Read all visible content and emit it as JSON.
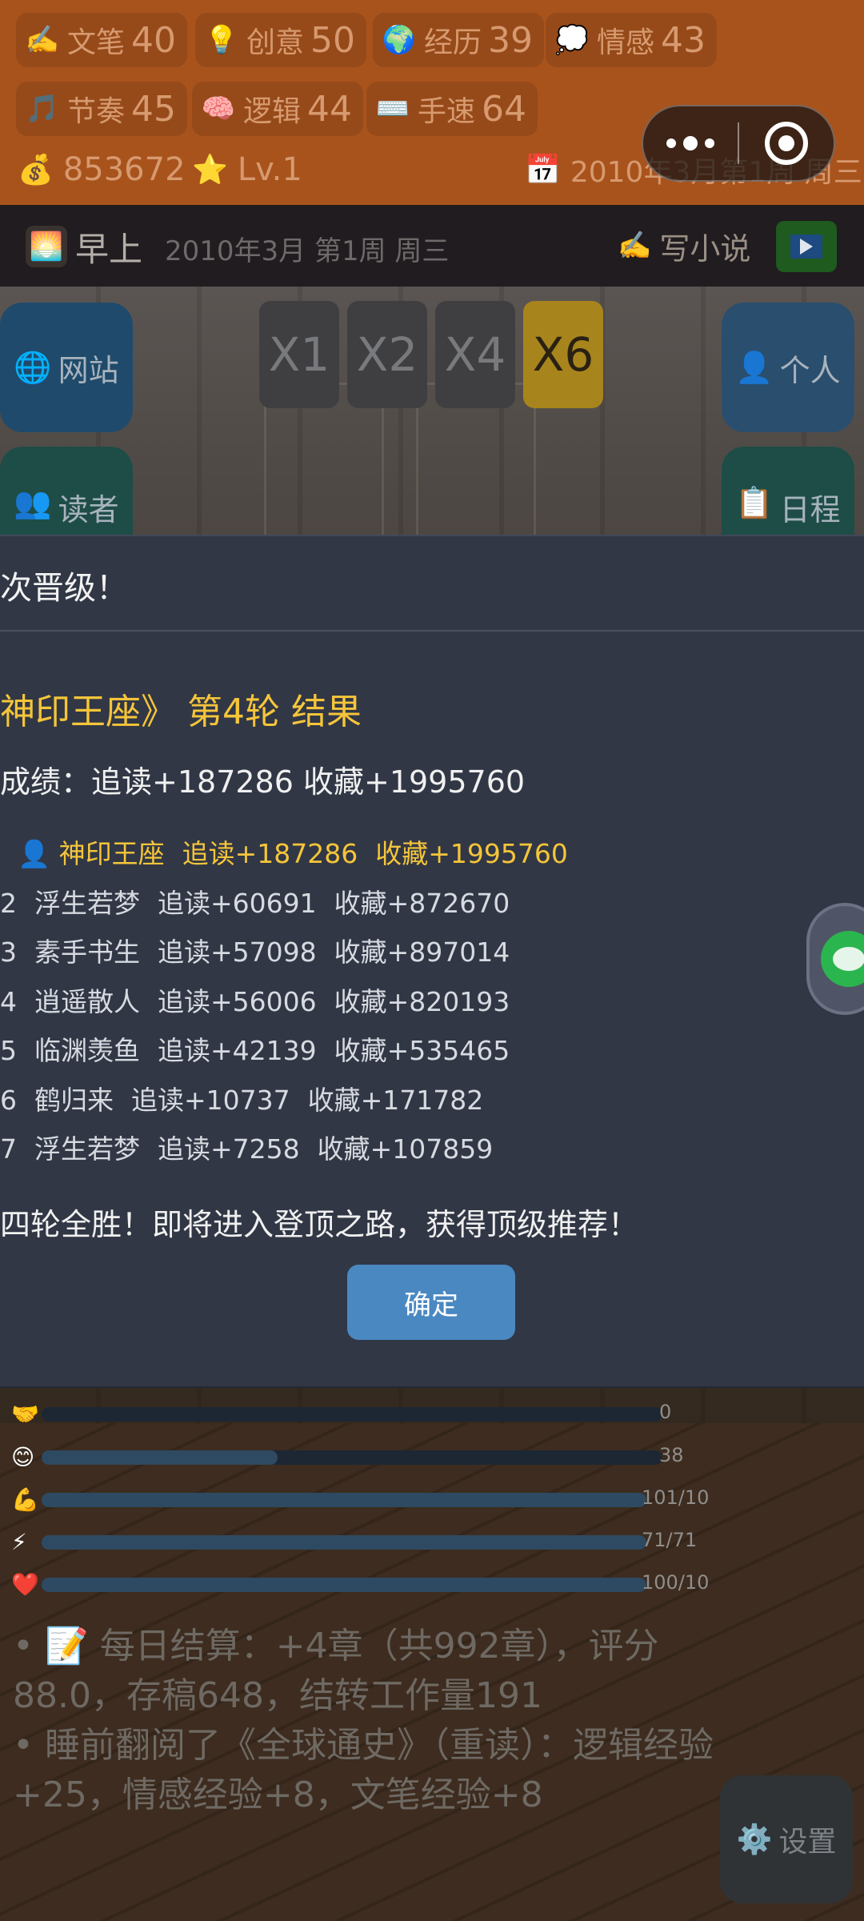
{
  "stats": [
    {
      "icon": "✍️",
      "name": "文笔",
      "value": "40"
    },
    {
      "icon": "💡",
      "name": "创意",
      "value": "50"
    },
    {
      "icon": "🌍",
      "name": "经历",
      "value": "39"
    },
    {
      "icon": "💭",
      "name": "情感",
      "value": "43"
    },
    {
      "icon": "🎵",
      "name": "节奏",
      "value": "45"
    },
    {
      "icon": "🧠",
      "name": "逻辑",
      "value": "44"
    },
    {
      "icon": "⌨️",
      "name": "手速",
      "value": "64"
    }
  ],
  "money": {
    "icon": "💰",
    "value": "853672"
  },
  "level": {
    "icon": "⭐",
    "value": "Lv.1"
  },
  "calendar": {
    "icon": "📅",
    "text": "2010年3月第1周 周三"
  },
  "time_bar": {
    "icon": "🌅",
    "period": "早上",
    "date": "2010年3月 第1周 周三",
    "write_icon": "✍️",
    "write_label": "写小说"
  },
  "side_buttons": {
    "website": {
      "icon": "🌐",
      "label": "网站"
    },
    "personal": {
      "icon": "👤",
      "label": "个人"
    },
    "reader": {
      "icon": "👥",
      "label": "读者"
    },
    "schedule": {
      "icon": "📋",
      "label": "日程"
    },
    "settings": {
      "icon": "⚙️",
      "label": "设置"
    }
  },
  "speed": {
    "options": [
      "X1",
      "X2",
      "X4",
      "X6"
    ],
    "active": "X6"
  },
  "dialog": {
    "title": "次晋级！",
    "round_title": "神印王座》 第4轮 结果",
    "score": "成绩：追读+187286  收藏+1995760",
    "rankings": [
      {
        "rank": "",
        "name": "👤 神印王座",
        "follow": "追读+187286",
        "collect": "收藏+1995760",
        "me": true
      },
      {
        "rank": "2",
        "name": "浮生若梦",
        "follow": "追读+60691",
        "collect": "收藏+872670"
      },
      {
        "rank": "3",
        "name": "素手书生",
        "follow": "追读+57098",
        "collect": "收藏+897014"
      },
      {
        "rank": "4",
        "name": "逍遥散人",
        "follow": "追读+56006",
        "collect": "收藏+820193"
      },
      {
        "rank": "5",
        "name": "临渊羡鱼",
        "follow": "追读+42139",
        "collect": "收藏+535465"
      },
      {
        "rank": "6",
        "name": "鹤归来",
        "follow": "追读+10737",
        "collect": "收藏+171782"
      },
      {
        "rank": "7",
        "name": "浮生若梦",
        "follow": "追读+7258",
        "collect": "收藏+107859"
      }
    ],
    "message": "四轮全胜！即将进入登顶之路，获得顶级推荐！",
    "confirm": "确定"
  },
  "bars": [
    {
      "icon": "🤝",
      "value": "0",
      "fraction": 0,
      "color": "#1d2734"
    },
    {
      "icon": "😊",
      "value": "38",
      "fraction": 0.38,
      "color": "#2e4a62"
    },
    {
      "icon": "💪",
      "value": "101/10",
      "fraction": 1,
      "color": "#2e4a62"
    },
    {
      "icon": "⚡",
      "value": "71/71",
      "fraction": 1,
      "color": "#2e4a62"
    },
    {
      "icon": "❤️",
      "value": "100/10",
      "fraction": 1,
      "color": "#2e4a62"
    }
  ],
  "log": [
    "• 📝 每日结算：+4章（共992章），评分88.0，存稿648，结转工作量191",
    "• 睡前翻阅了《全球通史》（重读）：逻辑经验+25，情感经验+8，文笔经验+8"
  ]
}
